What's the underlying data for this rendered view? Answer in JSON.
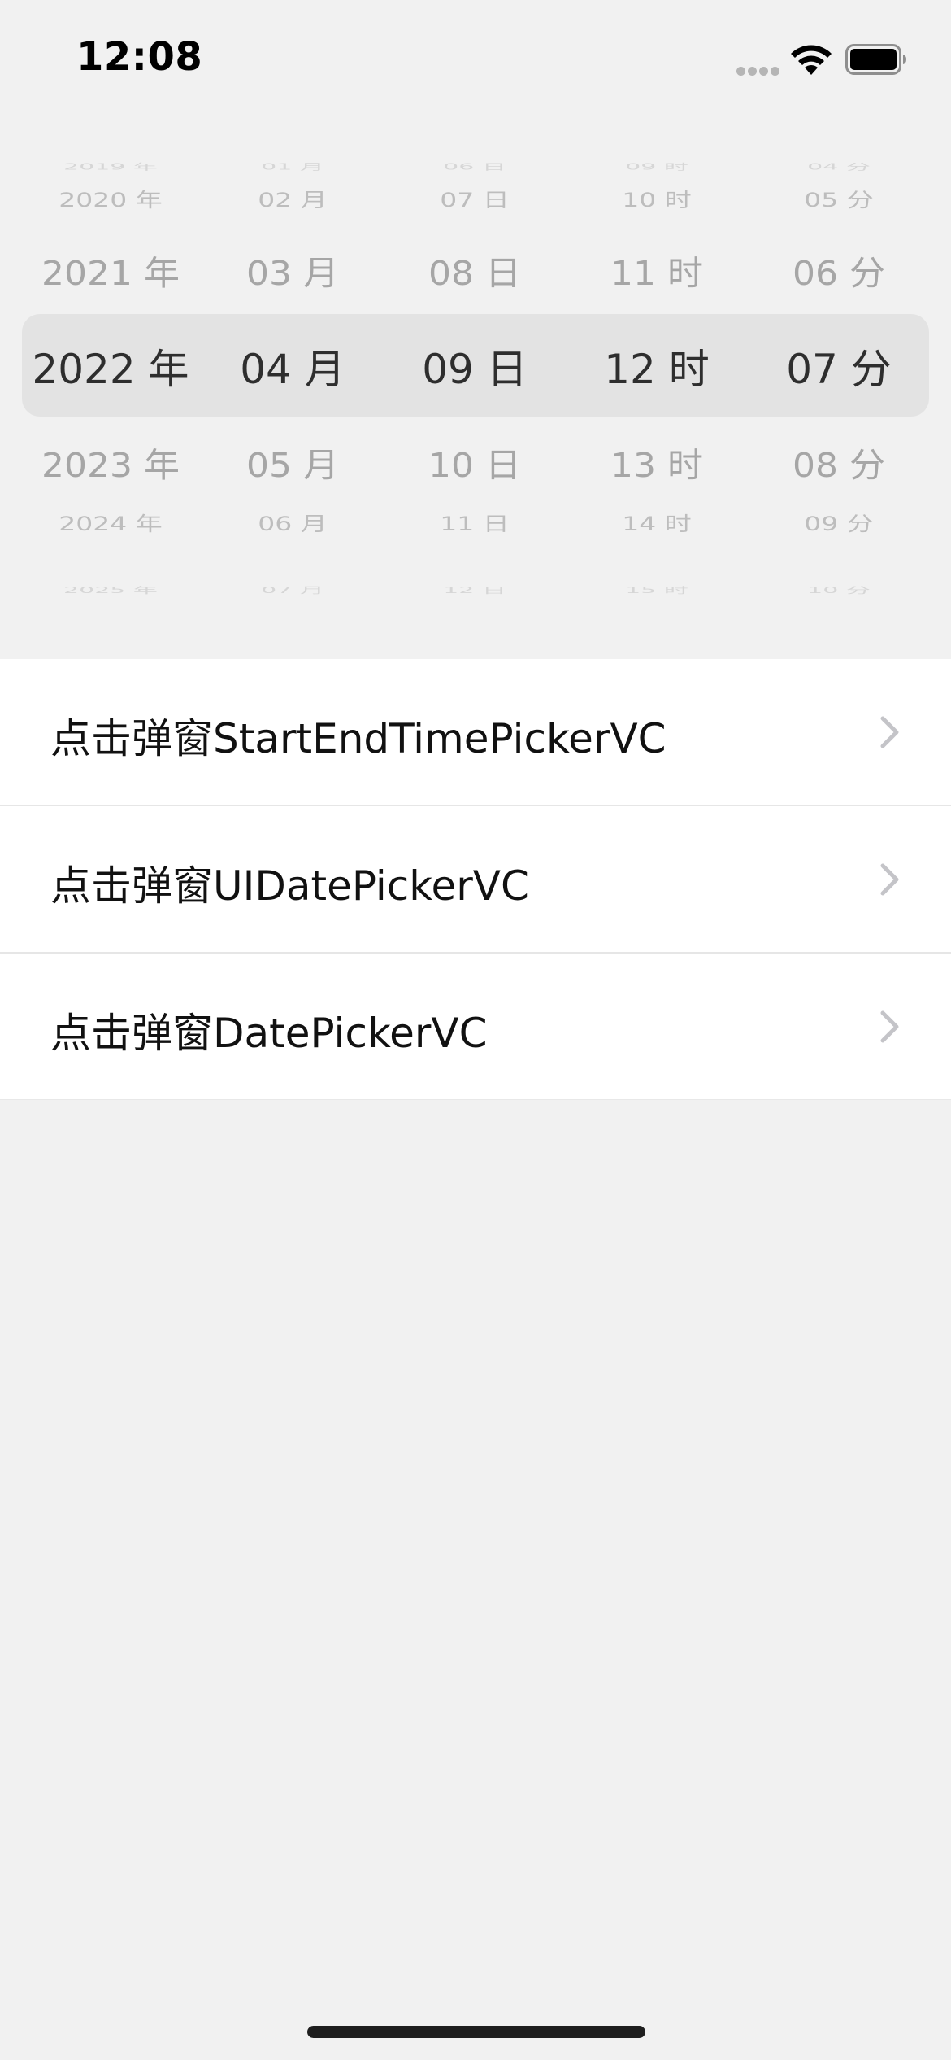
{
  "status_bar": {
    "time": "12:08",
    "signal_icon": "cellular-signal-icon",
    "wifi_icon": "wifi-icon",
    "battery_icon": "battery-icon"
  },
  "picker": {
    "selected_row_color": "#e3e3e3",
    "columns": [
      {
        "name": "year",
        "edge_top": "2019 年",
        "far_top": "2020 年",
        "near_top": "2021 年",
        "selected": "2022 年",
        "near_bottom": "2023 年",
        "far_bottom": "2024 年",
        "edge_bottom": "2025 年"
      },
      {
        "name": "month",
        "edge_top": "01 月",
        "far_top": "02 月",
        "near_top": "03 月",
        "selected": "04 月",
        "near_bottom": "05 月",
        "far_bottom": "06 月",
        "edge_bottom": "07 月"
      },
      {
        "name": "day",
        "edge_top": "06 日",
        "far_top": "07 日",
        "near_top": "08 日",
        "selected": "09 日",
        "near_bottom": "10 日",
        "far_bottom": "11 日",
        "edge_bottom": "12 日"
      },
      {
        "name": "hour",
        "edge_top": "09 时",
        "far_top": "10 时",
        "near_top": "11 时",
        "selected": "12 时",
        "near_bottom": "13 时",
        "far_bottom": "14 时",
        "edge_bottom": "15 时"
      },
      {
        "name": "minute",
        "edge_top": "04 分",
        "far_top": "05 分",
        "near_top": "06 分",
        "selected": "07 分",
        "near_bottom": "08 分",
        "far_bottom": "09 分",
        "edge_bottom": "10 分"
      }
    ]
  },
  "menu": {
    "items": [
      {
        "label": "点击弹窗StartEndTimePickerVC",
        "icon": "chevron-right-icon"
      },
      {
        "label": "点击弹窗UIDatePickerVC",
        "icon": "chevron-right-icon"
      },
      {
        "label": "点击弹窗DatePickerVC",
        "icon": "chevron-right-icon"
      }
    ]
  },
  "colors": {
    "background": "#f1f1f1",
    "list_background": "#ffffff",
    "chevron": "#c4c4c8",
    "home_indicator": "#1e1e1e"
  }
}
